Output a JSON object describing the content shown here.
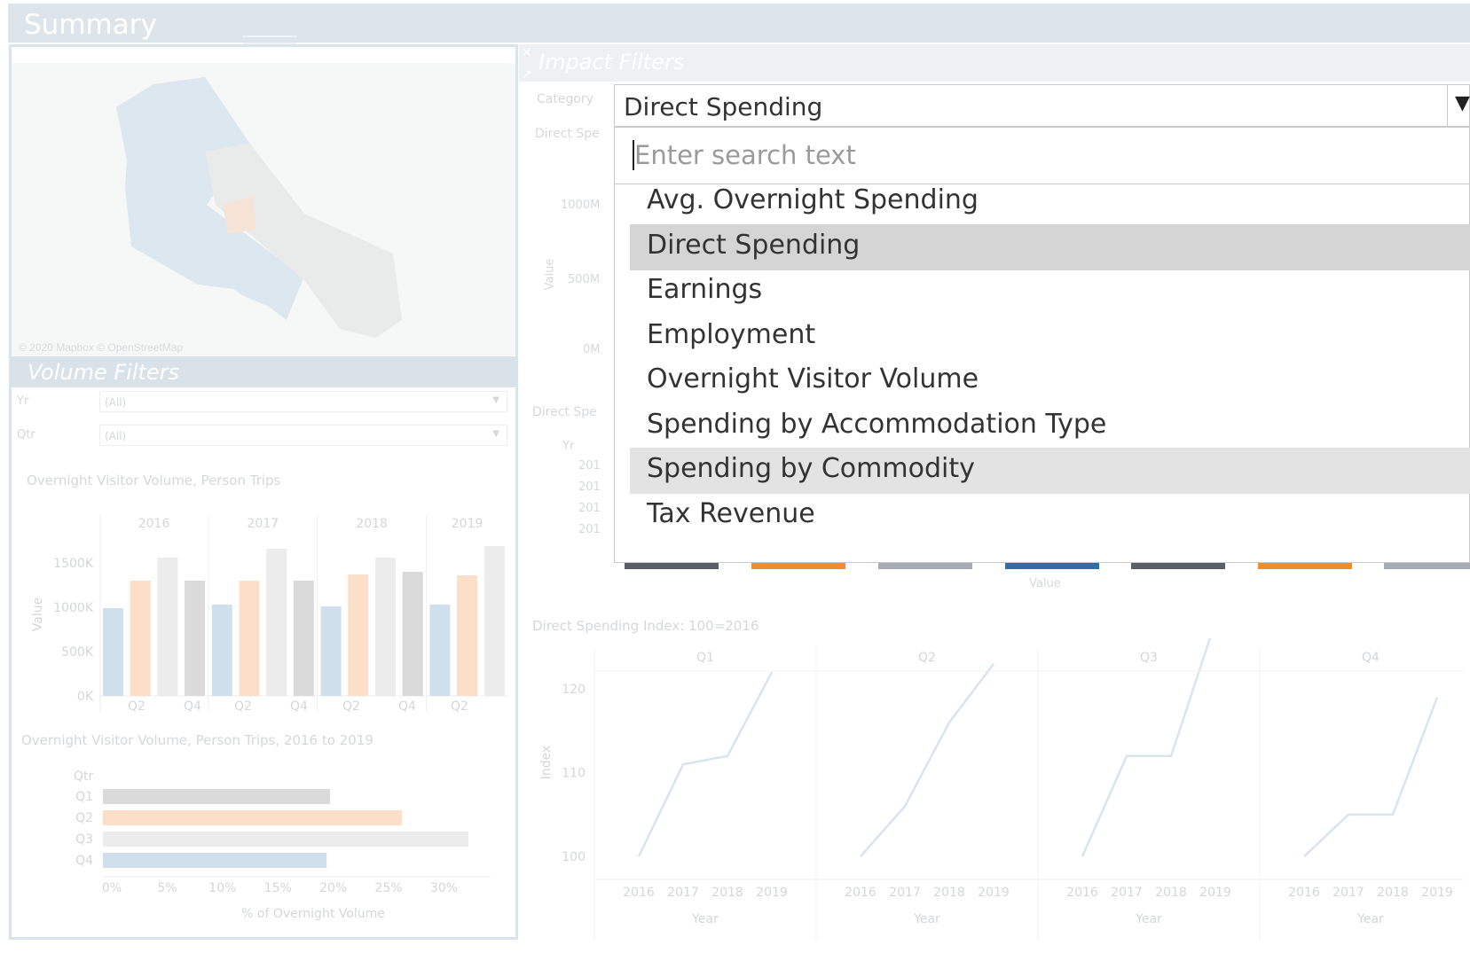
{
  "dashboard": {
    "title": "Summary"
  },
  "map": {
    "attribution": "© 2020 Mapbox © OpenStreetMap"
  },
  "volume_filters": {
    "header": "Volume Filters",
    "filters": [
      {
        "label": "Yr",
        "value": "(All)"
      },
      {
        "label": "Qtr",
        "value": "(All)"
      }
    ]
  },
  "impact_filters": {
    "header": "Impact Filters",
    "category_label": "Category",
    "selected_value": "Direct Spending",
    "search_placeholder": "Enter search text",
    "options": [
      "Avg. Overnight Spending",
      "Direct Spending",
      "Earnings",
      "Employment",
      "Overnight Visitor Volume",
      "Spending by Accommodation Type",
      "Spending by Commodity",
      "Tax Revenue"
    ],
    "selected_index": 1,
    "hovered_index": 6,
    "behind_labels": {
      "ds1": "Direct Spe",
      "ds2": "Direct Spe",
      "yr": "Yr",
      "value": "Value",
      "y_ticks": [
        "1000M",
        "500M",
        "0M"
      ],
      "yr_ticks": [
        "201",
        "201",
        "201",
        "201"
      ]
    },
    "colors": {
      "selected": "#d5d5d5",
      "hover": "#e3e3e3"
    }
  },
  "chart_data": [
    {
      "type": "bar",
      "title": "Overnight Visitor Volume, Person Trips",
      "ylabel": "Value",
      "ylim": [
        0,
        1800000
      ],
      "y_ticks": [
        "0K",
        "500K",
        "1000K",
        "1500K"
      ],
      "groups": [
        "2016",
        "2017",
        "2018",
        "2019"
      ],
      "x_tick_labels": [
        "Q2",
        "Q4",
        "Q2",
        "Q4",
        "Q2",
        "Q4",
        "Q2"
      ],
      "bars": [
        {
          "year": "2016",
          "qtr": "Q1",
          "value": 990000
        },
        {
          "year": "2016",
          "qtr": "Q2",
          "value": 1300000
        },
        {
          "year": "2016",
          "qtr": "Q3",
          "value": 1560000
        },
        {
          "year": "2016",
          "qtr": "Q4",
          "value": 1300000
        },
        {
          "year": "2017",
          "qtr": "Q1",
          "value": 1030000
        },
        {
          "year": "2017",
          "qtr": "Q2",
          "value": 1300000
        },
        {
          "year": "2017",
          "qtr": "Q3",
          "value": 1660000
        },
        {
          "year": "2017",
          "qtr": "Q4",
          "value": 1300000
        },
        {
          "year": "2018",
          "qtr": "Q1",
          "value": 1010000
        },
        {
          "year": "2018",
          "qtr": "Q2",
          "value": 1370000
        },
        {
          "year": "2018",
          "qtr": "Q3",
          "value": 1560000
        },
        {
          "year": "2018",
          "qtr": "Q4",
          "value": 1400000
        },
        {
          "year": "2019",
          "qtr": "Q1",
          "value": 1030000
        },
        {
          "year": "2019",
          "qtr": "Q2",
          "value": 1360000
        },
        {
          "year": "2019",
          "qtr": "Q3",
          "value": 1690000
        }
      ],
      "colors": {
        "Q1": "#cfe0ec",
        "Q2": "#fbdfc8",
        "Q3": "#ececec",
        "Q4": "#dadadb"
      }
    },
    {
      "type": "bar",
      "orientation": "horizontal",
      "title": "Overnight Visitor Volume, Person Trips, 2016 to 2019",
      "xlabel": "% of Overnight Volume",
      "ylabel": "Qtr",
      "categories": [
        "Q1",
        "Q2",
        "Q3",
        "Q4"
      ],
      "values": [
        20.5,
        27.0,
        33.0,
        20.2
      ],
      "xlim": [
        0,
        33
      ],
      "x_ticks": [
        "0%",
        "5%",
        "10%",
        "15%",
        "20%",
        "25%",
        "30%"
      ],
      "colors": [
        "#dadadb",
        "#fbdfc8",
        "#ececec",
        "#cfe0ec"
      ]
    },
    {
      "type": "line",
      "title": "Direct Spending Index: 100=2016",
      "ylabel": "Index",
      "xlabel": "Year",
      "ylim": [
        98,
        125
      ],
      "y_ticks": [
        100,
        110,
        120
      ],
      "x": [
        "2016",
        "2017",
        "2018",
        "2019"
      ],
      "panels": [
        {
          "name": "Q1",
          "values": [
            100,
            111,
            112,
            122
          ]
        },
        {
          "name": "Q2",
          "values": [
            100,
            106,
            116,
            123
          ]
        },
        {
          "name": "Q3",
          "values": [
            100,
            112,
            112,
            128
          ]
        },
        {
          "name": "Q4",
          "values": [
            100,
            105,
            105,
            119
          ]
        }
      ],
      "color": "#d8e4ee"
    }
  ]
}
